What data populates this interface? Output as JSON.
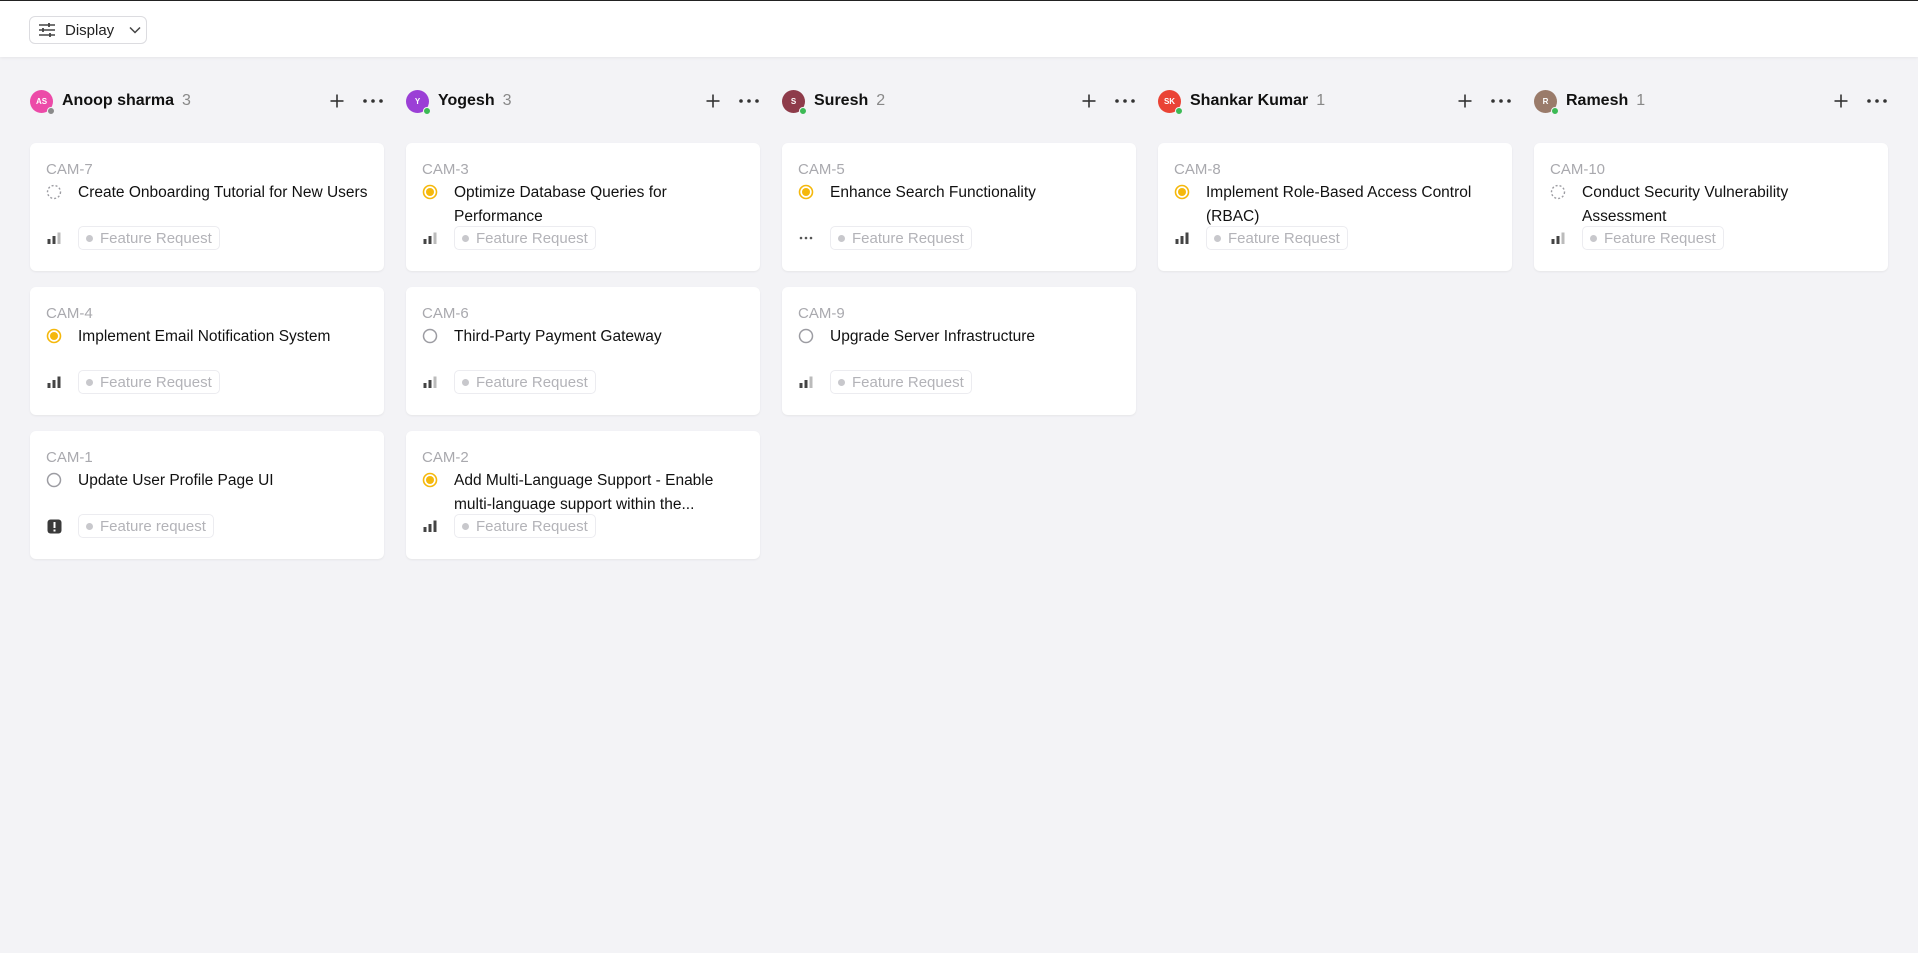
{
  "toolbar": {
    "display_label": "Display"
  },
  "colors": {
    "in_progress": "#f5b80c",
    "todo": "#9c9ca2",
    "urgent": "#3a3a3a",
    "online": "#3cba55"
  },
  "columns": [
    {
      "name": "Anoop sharma",
      "count": "3",
      "initials": "AS",
      "avatar_color": "#ec4aa8",
      "status": "gray",
      "cards": [
        {
          "id": "CAM-7",
          "title": "Create Onboarding Tutorial for New Users",
          "status": "backlog",
          "priority": "medium",
          "label": "Feature Request"
        },
        {
          "id": "CAM-4",
          "title": "Implement Email Notification System",
          "status": "in-progress",
          "priority": "high",
          "label": "Feature Request"
        },
        {
          "id": "CAM-1",
          "title": "Update User Profile Page UI",
          "status": "todo",
          "priority": "urgent",
          "label": "Feature request"
        }
      ]
    },
    {
      "name": "Yogesh",
      "count": "3",
      "initials": "Y",
      "avatar_color": "#9b3fd6",
      "status": "online",
      "cards": [
        {
          "id": "CAM-3",
          "title": "Optimize Database Queries for Performance",
          "status": "in-progress",
          "priority": "medium",
          "label": "Feature Request"
        },
        {
          "id": "CAM-6",
          "title": "Third-Party Payment Gateway",
          "status": "todo",
          "priority": "medium",
          "label": "Feature Request"
        },
        {
          "id": "CAM-2",
          "title": "Add Multi-Language Support - Enable multi-language support within the...",
          "status": "in-progress",
          "priority": "high",
          "label": "Feature Request"
        }
      ]
    },
    {
      "name": "Suresh",
      "count": "2",
      "initials": "S",
      "avatar_color": "#8e3b4a",
      "status": "online",
      "cards": [
        {
          "id": "CAM-5",
          "title": "Enhance Search Functionality",
          "status": "in-progress",
          "priority": "none",
          "label": "Feature Request"
        },
        {
          "id": "CAM-9",
          "title": "Upgrade Server Infrastructure",
          "status": "todo",
          "priority": "medium",
          "label": "Feature Request"
        }
      ]
    },
    {
      "name": "Shankar Kumar",
      "count": "1",
      "initials": "SK",
      "avatar_color": "#ea4335",
      "status": "online",
      "cards": [
        {
          "id": "CAM-8",
          "title": "Implement Role-Based Access Control (RBAC)",
          "status": "in-progress",
          "priority": "high",
          "label": "Feature Request"
        }
      ]
    },
    {
      "name": "Ramesh",
      "count": "1",
      "initials": "R",
      "avatar_color": "#9a7b6a",
      "status": "online",
      "cards": [
        {
          "id": "CAM-10",
          "title": "Conduct Security Vulnerability Assessment",
          "status": "backlog",
          "priority": "medium",
          "label": "Feature Request"
        }
      ]
    }
  ]
}
